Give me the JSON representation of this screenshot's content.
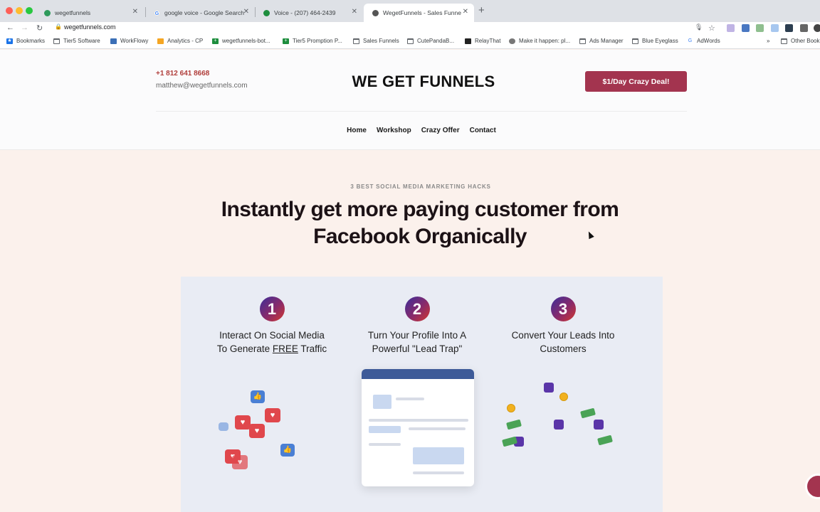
{
  "browser": {
    "tabs": [
      {
        "title": "wegetfunnels",
        "icon": "green-globe-icon",
        "active": false
      },
      {
        "title": "google voice - Google Search",
        "icon": "google-icon",
        "active": false
      },
      {
        "title": "Voice - (207) 464-2439",
        "icon": "phone-icon",
        "active": false
      },
      {
        "title": "WegetFunnels - Sales Funne",
        "icon": "site-icon",
        "active": true
      }
    ],
    "new_tab": "+",
    "url": "wegetfunnels.com",
    "bookmarks": [
      {
        "label": "Bookmarks",
        "icon": "star-icon"
      },
      {
        "label": "Tier5 Software",
        "icon": "folder-icon"
      },
      {
        "label": "WorkFlowy",
        "icon": "workflowy-icon"
      },
      {
        "label": "Analytics - CP",
        "icon": "analytics-icon"
      },
      {
        "label": "wegetfunnels-bot...",
        "icon": "plus-icon"
      },
      {
        "label": "Tier5 Promption P...",
        "icon": "plus-icon"
      },
      {
        "label": "Sales Funnels",
        "icon": "folder-icon"
      },
      {
        "label": "CutePandaB...",
        "icon": "folder-icon"
      },
      {
        "label": "RelayThat",
        "icon": "relay-icon"
      },
      {
        "label": "Make it happen: pl...",
        "icon": "globe-icon"
      },
      {
        "label": "Ads Manager",
        "icon": "folder-icon"
      },
      {
        "label": "Blue Eyeglass",
        "icon": "folder-icon"
      },
      {
        "label": "AdWords",
        "icon": "google-icon"
      },
      {
        "label": "»",
        "icon": "overflow-icon"
      },
      {
        "label": "Other Book",
        "icon": "folder-icon"
      }
    ]
  },
  "header": {
    "phone": "+1 812 641 8668",
    "email": "matthew@wegetfunnels.com",
    "logo": "WE GET FUNNELS",
    "cta": "$1/Day Crazy Deal!",
    "nav": [
      "Home",
      "Workshop",
      "Crazy Offer",
      "Contact"
    ]
  },
  "hero": {
    "eyebrow": "3 BEST SOCIAL MEDIA MARKETING HACKS",
    "headline_line1": "Instantly get more paying customer from",
    "headline_line2": "Facebook Organically"
  },
  "steps": [
    {
      "number": "1",
      "line1": "Interact On Social Media",
      "line2_pre": "To Generate ",
      "line2_em": "FREE",
      "line2_post": " Traffic"
    },
    {
      "number": "2",
      "line1": "Turn Your Profile Into A",
      "line2_pre": "Powerful \"Lead Trap\"",
      "line2_em": "",
      "line2_post": ""
    },
    {
      "number": "3",
      "line1": "Convert Your Leads Into",
      "line2_pre": "Customers",
      "line2_em": "",
      "line2_post": ""
    }
  ],
  "colors": {
    "accent": "#a3344f",
    "phone": "#b03d3a",
    "page_bg": "#fbf1ec",
    "panel_bg": "#e9ecf4"
  }
}
